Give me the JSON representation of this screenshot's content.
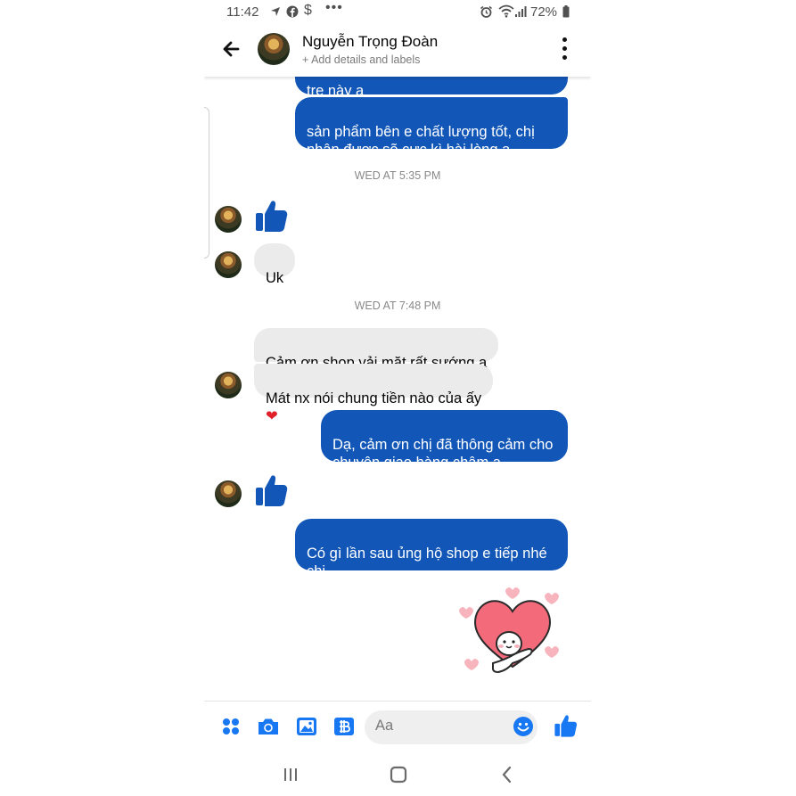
{
  "status_bar": {
    "time": "11:42",
    "battery": "72%",
    "notif_icons": [
      "navigation-icon",
      "facebook-icon",
      "dollar-icon",
      "more-dots-icon"
    ],
    "right_icons": [
      "alarm-icon",
      "wifi-icon",
      "signal-icon",
      "battery-icon"
    ]
  },
  "header": {
    "name": "Nguyễn Trọng Đoàn",
    "subtitle": "+ Add details and labels"
  },
  "messages": {
    "m1_partial": "tre này ạ",
    "m2": "sản phẩm bên e chất lượng tốt, chị\nnhận được sẽ cực kì hài lòng ạ.",
    "stamp1": "WED AT 5:35 PM",
    "m3": "Uk",
    "stamp2": "WED AT 7:48 PM",
    "m4": "Cảm ơn shop vải mặt rất sướng ạ",
    "m5": "Mát nx nói chung tiền nào của ấy",
    "m6": "Dạ, cảm ơn chị đã thông cảm cho\nchuyện giao hàng chậm ạ",
    "m7": "Có gì lần sau ủng hộ shop e tiếp nhé\nchị"
  },
  "composer": {
    "placeholder": "Aa"
  },
  "colors": {
    "outgoing": "#1257b8",
    "incoming": "#ebebeb",
    "accent": "#1877f2"
  }
}
